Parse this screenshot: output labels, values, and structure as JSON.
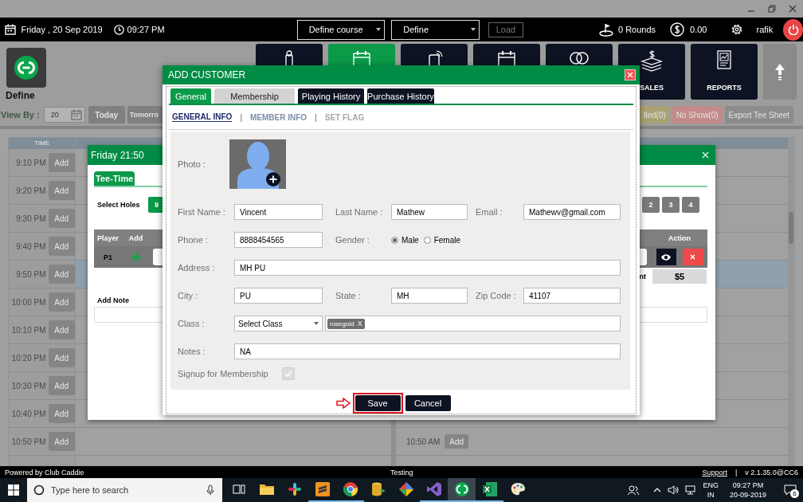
{
  "top_bar": {
    "date": "Friday ,  20 Sep 2019",
    "time": "09:27 PM",
    "course_select": "Define course",
    "define_select": "Define",
    "load_button": {
      "label": "Load",
      "disabled": true
    },
    "rounds": "0 Rounds",
    "balance": "0.00",
    "user": "rafik"
  },
  "nav": {
    "logo_label": "Define",
    "tiles": [
      {
        "kind": "club",
        "selected": false
      },
      {
        "kind": "calendar",
        "selected": true
      },
      {
        "kind": "phone",
        "selected": false
      },
      {
        "kind": "schedule",
        "selected": false
      },
      {
        "kind": "rings",
        "selected": false
      },
      {
        "kind": "money",
        "label": "SALES",
        "selected": false
      },
      {
        "kind": "report",
        "label": "REPORTS",
        "selected": false
      }
    ]
  },
  "view_bar": {
    "label": "View By :",
    "date_value": "20",
    "day_buttons": [
      "Today",
      "Tomorro"
    ],
    "status_buttons": [
      {
        "label": "lled(0)",
        "color": "#aaa274"
      },
      {
        "label": "No Show(0)",
        "color": "#c48a8a"
      },
      {
        "label": "Export Tee Sheet",
        "color": "#8c8c8c"
      }
    ]
  },
  "tee_sheet": {
    "time_header": "TIME",
    "rows": [
      {
        "time": "9:10 PM",
        "button": "Add",
        "selected": false
      },
      {
        "time": "9:20 PM",
        "button": "Add",
        "selected": false
      },
      {
        "time": "9:30 PM",
        "button": "Add",
        "selected": false
      },
      {
        "time": "9:40 PM",
        "button": "Add",
        "selected": false
      },
      {
        "time": "9:50 PM",
        "button": "Add",
        "selected": true
      },
      {
        "time": "10:00 PM",
        "button": "Add",
        "selected": false
      },
      {
        "time": "10:10 PM",
        "button": "Add",
        "selected": false
      },
      {
        "time": "10:20 PM",
        "button": "Add",
        "selected": false
      },
      {
        "time": "10:30 PM",
        "button": "Add",
        "selected": false
      },
      {
        "time": "10:40 PM",
        "button": "Add",
        "selected": false
      },
      {
        "time": "10:50 PM",
        "button": "Add",
        "selected": false
      }
    ],
    "right_slot": {
      "time": "10:50 AM",
      "button": "Add"
    }
  },
  "tee_time_dialog": {
    "title": "Friday 21:50",
    "tab": {
      "label": "Tee-Time",
      "selected": true
    },
    "select_holes_label": "Select Holes",
    "holes": [
      {
        "label": "9",
        "selected": true
      }
    ],
    "players": [
      {
        "label": "2",
        "selected": false
      },
      {
        "label": "3",
        "selected": false
      },
      {
        "label": "4",
        "selected": false
      }
    ],
    "columns": [
      "Player",
      "Add",
      "Action"
    ],
    "rows": [
      {
        "player": "P1"
      }
    ],
    "amount_label": "nt",
    "amount": "$5",
    "note_label": "Add Note"
  },
  "customer_dialog": {
    "title": "ADD CUSTOMER",
    "tabs": [
      {
        "label": "General",
        "kind": "light",
        "selected": true
      },
      {
        "label": "Membership",
        "kind": "light",
        "selected": false
      },
      {
        "label": "Playing History",
        "kind": "dark",
        "selected": false
      },
      {
        "label": "Purchase History",
        "kind": "dark",
        "selected": false
      }
    ],
    "subtabs": [
      {
        "label": "GENERAL INFO",
        "selected": true,
        "disabled": false
      },
      {
        "separator": "|",
        "label": "MEMBER INFO",
        "selected": false,
        "disabled": false
      },
      {
        "separator": "|",
        "label": "SET FLAG",
        "selected": false,
        "disabled": true
      }
    ],
    "form": {
      "photo_label": "Photo :",
      "rows": [
        [
          {
            "kind": "text",
            "label": "First Name :",
            "value": "Vincent"
          },
          {
            "kind": "text",
            "label": "Last Name :",
            "value": "Mathew"
          },
          {
            "kind": "text",
            "label": "Email :",
            "value": "Mathewv@gmail.com"
          }
        ],
        [
          {
            "kind": "text",
            "label": "Phone :",
            "value": "8888454565"
          },
          {
            "kind": "radio",
            "label": "Gender :",
            "options": [
              {
                "label": "Male",
                "selected": true
              },
              {
                "label": "Female",
                "selected": false
              }
            ]
          }
        ],
        [
          {
            "kind": "wide",
            "label": "Address :",
            "value": "MH PU"
          }
        ],
        [
          {
            "kind": "text",
            "label": "City :",
            "value": "PU"
          },
          {
            "kind": "text",
            "label": "State :",
            "value": "MH"
          },
          {
            "kind": "text",
            "label": "Zip Code :",
            "value": "41107"
          }
        ],
        [
          {
            "kind": "class",
            "label": "Class :",
            "select": "Select Class",
            "tags": [
              {
                "label": "rosegold",
                "remove": "X"
              }
            ]
          }
        ],
        [
          {
            "kind": "wide",
            "label": "Notes :",
            "value": "NA"
          }
        ]
      ],
      "signup": {
        "label": "Signup for Membership",
        "checked": true,
        "disabled": true
      }
    },
    "buttons": [
      {
        "label": "Save",
        "highlighted": true
      },
      {
        "label": "Cancel",
        "highlighted": false
      }
    ]
  },
  "status_bar": {
    "left": "Powered by Club Caddie",
    "center": "Testing",
    "support": "Support",
    "separator": "|",
    "version": "v 2.1.35.0@CC6"
  },
  "taskbar": {
    "search_placeholder": "Type here to search",
    "apps": [
      {
        "kind": "task_view",
        "running": false,
        "selected": false
      },
      {
        "kind": "folder",
        "running": false,
        "selected": false
      },
      {
        "kind": "pinwheel",
        "running": false,
        "selected": false
      },
      {
        "kind": "stripes",
        "running": true,
        "selected": false
      },
      {
        "kind": "browser",
        "running": true,
        "selected": false
      },
      {
        "kind": "database",
        "running": false,
        "selected": false
      },
      {
        "kind": "diamond",
        "running": false,
        "selected": false
      },
      {
        "kind": "ribbon",
        "running": true,
        "selected": false
      },
      {
        "kind": "rings",
        "running": true,
        "selected": true
      },
      {
        "kind": "sheet",
        "running": true,
        "selected": false
      },
      {
        "kind": "palette",
        "running": false,
        "selected": false
      }
    ],
    "language": "ENG",
    "region": "IN",
    "time": "09:27 PM",
    "date": "20-09-2019",
    "notifications": "6"
  }
}
